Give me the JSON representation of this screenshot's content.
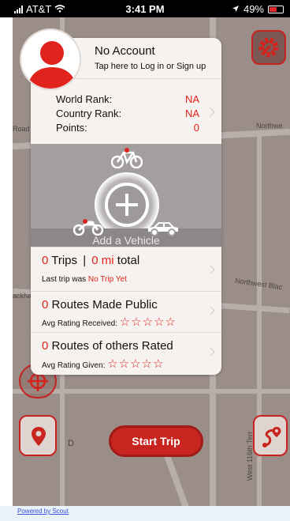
{
  "status_bar": {
    "carrier": "AT&T",
    "time": "3:41 PM",
    "battery": "49%"
  },
  "map": {
    "street_labels": [
      "Road",
      "Northwe",
      "Northwest Blac",
      "ackha",
      "West 116th Terr",
      "D"
    ],
    "powered_by": "Powered by Scout"
  },
  "account": {
    "title": "No Account",
    "subtitle": "Tap here to Log in or Sign up"
  },
  "ranks": [
    {
      "label": "World Rank:",
      "value": "NA"
    },
    {
      "label": "Country Rank:",
      "value": "NA"
    },
    {
      "label": "Points:",
      "value": "0"
    }
  ],
  "vehicle": {
    "add_label": "Add a Vehicle"
  },
  "trips": {
    "count": "0",
    "count_label": "Trips",
    "separator": "|",
    "distance": "0 mi",
    "distance_label": "total",
    "last_trip_label": "Last trip was",
    "last_trip_value": "No Trip Yet"
  },
  "routes_public": {
    "count": "0",
    "label": "Routes Made Public",
    "rating_label": "Avg Rating Received:",
    "stars": "☆☆☆☆☆",
    "rating": 0
  },
  "routes_rated": {
    "count": "0",
    "label": "Routes of others Rated",
    "rating_label": "Avg Rating Given:",
    "stars": "☆☆☆☆☆",
    "rating": 0
  },
  "buttons": {
    "start_trip": "Start Trip"
  },
  "colors": {
    "accent": "#e0231c",
    "button_red": "#c9251f"
  },
  "icons": [
    "settings-gear-icon",
    "crosshair-icon",
    "location-pin-icon",
    "route-icon",
    "bicycle-icon",
    "motorcycle-icon",
    "car-icon",
    "plus-icon",
    "chevron-right-icon"
  ]
}
